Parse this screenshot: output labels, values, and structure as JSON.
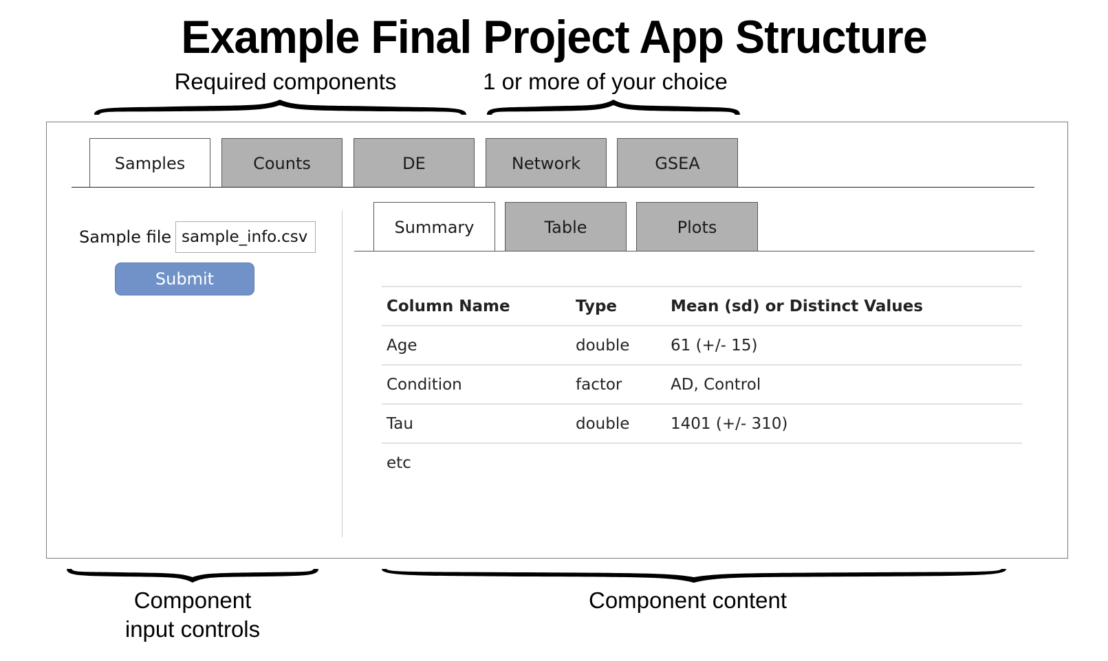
{
  "title": "Example Final Project App Structure",
  "annotations": {
    "required": "Required components",
    "choice": "1 or more of your choice",
    "inputs_line1": "Component",
    "inputs_line2": "input controls",
    "content": "Component content"
  },
  "main_tabs": [
    {
      "label": "Samples",
      "active": true
    },
    {
      "label": "Counts",
      "active": false
    },
    {
      "label": "DE",
      "active": false
    },
    {
      "label": "Network",
      "active": false
    },
    {
      "label": "GSEA",
      "active": false
    }
  ],
  "sidebar": {
    "sample_file_label": "Sample file",
    "sample_file_value": "sample_info.csv",
    "submit_label": "Submit"
  },
  "sub_tabs": [
    {
      "label": "Summary",
      "active": true
    },
    {
      "label": "Table",
      "active": false
    },
    {
      "label": "Plots",
      "active": false
    }
  ],
  "summary_table": {
    "headers": [
      "Column Name",
      "Type",
      "Mean (sd) or Distinct Values"
    ],
    "rows": [
      [
        "Age",
        "double",
        "61 (+/- 15)"
      ],
      [
        "Condition",
        "factor",
        "AD, Control"
      ],
      [
        "Tau",
        "double",
        "1401 (+/- 310)"
      ],
      [
        "etc",
        "",
        ""
      ]
    ]
  },
  "colors": {
    "inactive_tab": "#b0b1b0",
    "submit_button": "#7092c9",
    "table_rule": "#dee2e6"
  }
}
